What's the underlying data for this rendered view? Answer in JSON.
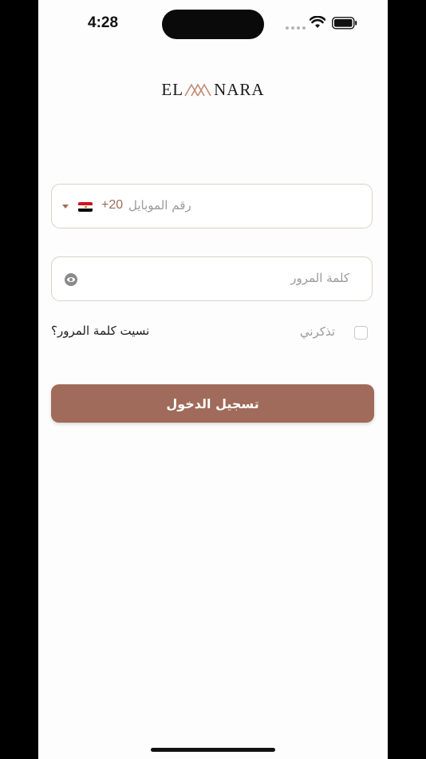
{
  "status_bar": {
    "time": "4:28"
  },
  "logo": {
    "left_text": "EL",
    "right_text": "NARA",
    "accent_color": "#c48a78"
  },
  "login_form": {
    "phone": {
      "country_code": "+20",
      "flag": "egypt-flag",
      "placeholder": "رقم الموبايل"
    },
    "password": {
      "placeholder": "كلمة المرور",
      "visibility_icon": "eye-icon"
    },
    "remember_me_label": "تذكرني",
    "forgot_password_label": "نسيت كلمة المرور؟",
    "submit_label": "تسجيل الدخول"
  },
  "colors": {
    "brand": "#a06b5a",
    "code_text": "#9e6a58",
    "placeholder": "#9a9a9a",
    "border": "#d8d2cc"
  }
}
